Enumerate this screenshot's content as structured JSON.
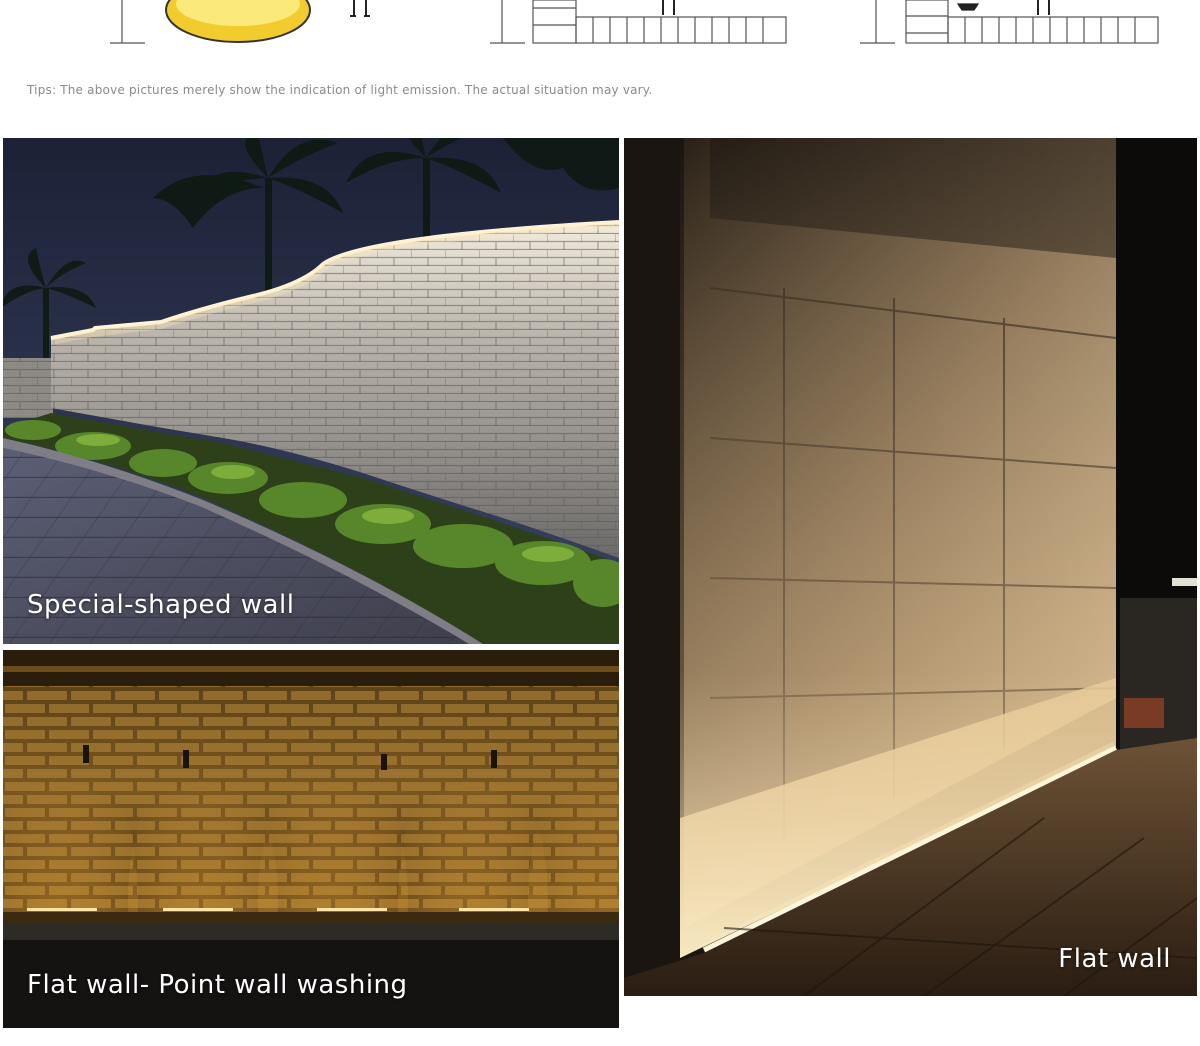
{
  "tips": "Tips: The above pictures merely show the indication of light emission. The actual situation may vary.",
  "photos": [
    {
      "caption": "Special-shaped wall"
    },
    {
      "caption": "Flat wall- Point wall washing"
    },
    {
      "caption": "Flat wall"
    }
  ],
  "colors": {
    "accent_yellow": "#f2cc2e",
    "line_gray": "#555555",
    "tips_gray": "#8a8a8a",
    "warm_light": "#e8b24a"
  }
}
